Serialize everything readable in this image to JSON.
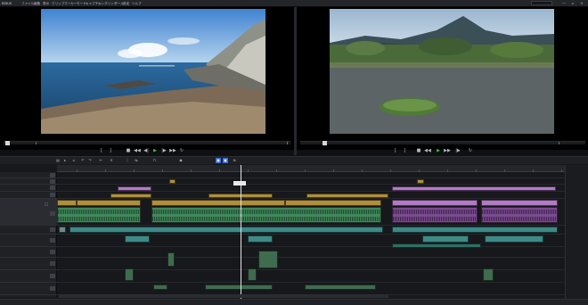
{
  "app": {
    "name": "EDIUS"
  },
  "menu": [
    "ファイル",
    "編集",
    "表示",
    "クリップ",
    "マーカー",
    "モード",
    "キャプチャ",
    "レンダリング",
    "ツール",
    "設定",
    "ヘルプ"
  ],
  "window_controls": {
    "minimize": "—",
    "maximize": "▫",
    "close": "✕"
  },
  "layout_preset": "",
  "player": {
    "timecode_in": "",
    "timecode_out": "",
    "timecode_dur": "",
    "marks": [
      "",
      "",
      "",
      "",
      "",
      ""
    ]
  },
  "recorder": {
    "timecode": "",
    "timecode_out": "",
    "timecode_dur": ""
  },
  "timeline": {
    "tab_label": "",
    "ruler_current": "",
    "ruler_labels": [
      "",
      "",
      "",
      "",
      "",
      "",
      "",
      "",
      "",
      "",
      "",
      "",
      "",
      "",
      "",
      "",
      "",
      ""
    ],
    "playhead_tc": "",
    "tracks": [
      {
        "num": "",
        "name": "",
        "type": ""
      },
      {
        "num": "",
        "name": "",
        "type": ""
      },
      {
        "num": "",
        "name": "",
        "type": ""
      },
      {
        "num": "",
        "name": "",
        "type": ""
      },
      {
        "num": "",
        "name": "",
        "type": ""
      },
      {
        "num": "",
        "name": "",
        "type": ""
      },
      {
        "num": "",
        "name": "",
        "type": ""
      },
      {
        "num": "",
        "name": "",
        "type": ""
      },
      {
        "num": "",
        "name": "",
        "type": ""
      },
      {
        "num": "",
        "name": "",
        "type": ""
      },
      {
        "num": "",
        "name": "",
        "type": ""
      }
    ],
    "clips": {
      "c1": "",
      "c2": "",
      "c3": "",
      "c4": "",
      "c5": "",
      "c6": "",
      "c7": "",
      "c8": "",
      "c9": "",
      "c10": "",
      "c11": "",
      "c12": "",
      "c13": "",
      "c14": "",
      "c15": "",
      "c16": "",
      "c17": "",
      "c18": ""
    }
  },
  "status": {
    "left": "",
    "disk": "",
    "right": ""
  },
  "colors": {
    "accent": "#3a6bd6",
    "play": "#37c146",
    "clip_teal": "#3d8a87",
    "clip_gold": "#b08f3c",
    "clip_purple": "#b27ac6",
    "audio_green": "#40885a"
  },
  "icons": {
    "play": "▶",
    "stop": "■",
    "rewind": "◀◀",
    "ffwd": "▶▶",
    "step_back": "◀|",
    "step_fwd": "|▶",
    "loop": "↻",
    "mark_in": "[",
    "mark_out": "]"
  }
}
